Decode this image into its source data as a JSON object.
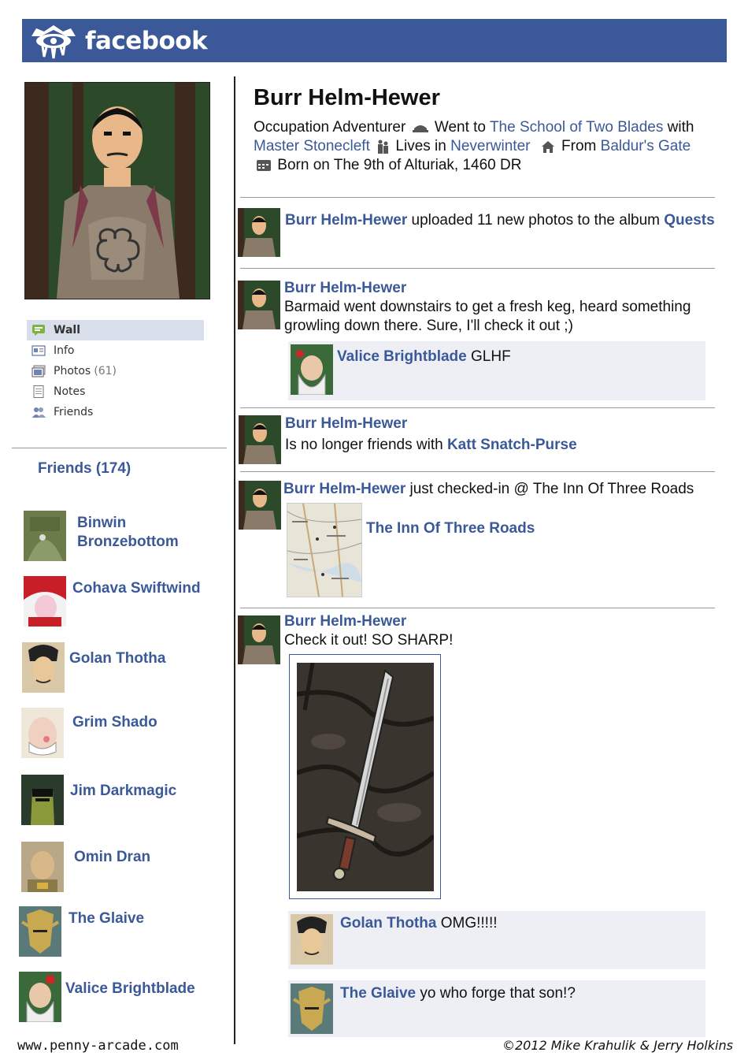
{
  "header": {
    "brand": "facebook",
    "brand_color": "#3b5998"
  },
  "profile": {
    "name": "Burr Helm-Hewer",
    "info": {
      "occupation_label": "Occupation",
      "occupation_value": "Adventurer",
      "went_label": "Went to",
      "school": "The School of Two Blades",
      "with_label": "with",
      "mentor": "Master Stonecleft",
      "lives_label": "Lives in",
      "lives_value": "Neverwinter",
      "from_label": "From",
      "from_value": "Baldur's Gate",
      "born": "Born on The 9th of Alturiak, 1460 DR"
    }
  },
  "nav": {
    "items": [
      {
        "label": "Wall",
        "icon": "wall-icon",
        "active": true
      },
      {
        "label": "Info",
        "icon": "info-icon"
      },
      {
        "label": "Photos",
        "count": "(61)",
        "icon": "photos-icon"
      },
      {
        "label": "Notes",
        "icon": "notes-icon"
      },
      {
        "label": "Friends",
        "icon": "friends-icon"
      }
    ]
  },
  "friends": {
    "heading": "Friends (174)",
    "list": [
      {
        "name": "Binwin Bronzebottom"
      },
      {
        "name": "Cohava Swiftwind"
      },
      {
        "name": "Golan Thotha"
      },
      {
        "name": "Grim Shado"
      },
      {
        "name": "Jim Darkmagic"
      },
      {
        "name": "Omin Dran"
      },
      {
        "name": "The Glaive"
      },
      {
        "name": "Valice Brightblade"
      }
    ]
  },
  "posts": [
    {
      "author": "Burr Helm-Hewer",
      "text": "uploaded 11 new photos to the album",
      "album": "Quests"
    },
    {
      "author": "Burr Helm-Hewer",
      "text": "Barmaid went downstairs to get a fresh keg, heard something growling down there.  Sure, I'll check it out ;)",
      "comment": {
        "author": "Valice Brightblade",
        "text": "GLHF"
      }
    },
    {
      "author": "Burr Helm-Hewer",
      "text_prefix": "Is no longer friends with",
      "target": "Katt Snatch-Purse"
    },
    {
      "author": "Burr Helm-Hewer",
      "text": "just checked-in @ The Inn Of Three Roads",
      "place": "The Inn Of Three Roads"
    },
    {
      "author": "Burr Helm-Hewer",
      "text": "Check it out!  SO SHARP!",
      "comments": [
        {
          "author": "Golan Thotha",
          "text": "OMG!!!!!"
        },
        {
          "author": "The Glaive",
          "text": "yo who forge that son!?"
        }
      ]
    }
  ],
  "footer": {
    "site": "www.penny-arcade.com",
    "credit": "©2012 Mike Krahulik & Jerry Holkins"
  }
}
